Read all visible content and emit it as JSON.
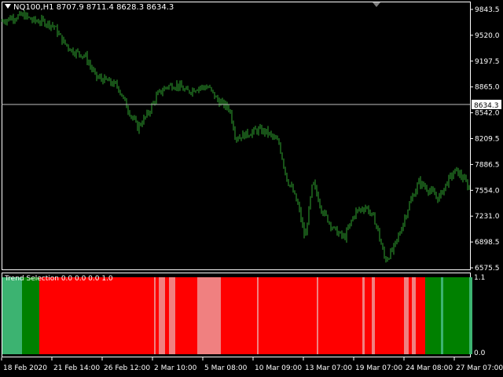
{
  "window": {
    "symbol": "NQ100,H1",
    "ohlc": [
      "8707.9",
      "8711.4",
      "8628.3",
      "8634.3"
    ]
  },
  "indicator": {
    "label": "Trend Selection 0.0 0.0 0.0 1.0",
    "scale": [
      "1.1",
      "0.0"
    ]
  },
  "price_axis": {
    "ticks": [
      "9843.5",
      "9520.0",
      "9197.5",
      "8865.0",
      "8542.0",
      "8209.5",
      "7886.5",
      "7554.0",
      "7231.0",
      "6898.5",
      "6575.5"
    ],
    "current_price": "8634.3"
  },
  "time_axis": {
    "ticks": [
      "18 Feb 2020",
      "21 Feb 14:00",
      "26 Feb 12:00",
      "2 Mar 10:00",
      "5 Mar 08:00",
      "10 Mar 09:00",
      "13 Mar 07:00",
      "19 Mar 07:00",
      "24 Mar 08:00",
      "27 Mar 07:00"
    ]
  },
  "colors": {
    "background": "#000000",
    "candle": "#2fa52f",
    "axis": "#ffffff",
    "price_line": "#c0c0c0",
    "red": "#ff0000",
    "light_red": "#f08080",
    "green": "#008000",
    "light_green": "#3cb371"
  },
  "chart_data": {
    "type": "line",
    "x": [
      "18 Feb 2020",
      "21 Feb 14:00",
      "26 Feb 12:00",
      "2 Mar 10:00",
      "5 Mar 08:00",
      "10 Mar 09:00",
      "13 Mar 07:00",
      "19 Mar 07:00",
      "24 Mar 08:00",
      "27 Mar 07:00"
    ],
    "series": [
      {
        "values": [
          9690,
          9620,
          8880,
          8340,
          8700,
          8440,
          7620,
          7050,
          7380,
          7720
        ]
      }
    ],
    "price_path": [
      [
        0,
        9690
      ],
      [
        15,
        9740
      ],
      [
        30,
        9770
      ],
      [
        42,
        9700
      ],
      [
        55,
        9690
      ],
      [
        68,
        9640
      ],
      [
        80,
        9440
      ],
      [
        92,
        9320
      ],
      [
        108,
        9260
      ],
      [
        122,
        8990
      ],
      [
        136,
        8940
      ],
      [
        150,
        8870
      ],
      [
        162,
        8600
      ],
      [
        175,
        8350
      ],
      [
        188,
        8520
      ],
      [
        200,
        8760
      ],
      [
        212,
        8870
      ],
      [
        225,
        8890
      ],
      [
        238,
        8800
      ],
      [
        252,
        8860
      ],
      [
        265,
        8860
      ],
      [
        278,
        8680
      ],
      [
        292,
        8590
      ],
      [
        300,
        8220
      ],
      [
        315,
        8270
      ],
      [
        328,
        8320
      ],
      [
        340,
        8290
      ],
      [
        355,
        8150
      ],
      [
        365,
        7700
      ],
      [
        372,
        7560
      ],
      [
        380,
        7340
      ],
      [
        388,
        6940
      ],
      [
        398,
        7660
      ],
      [
        410,
        7300
      ],
      [
        425,
        7060
      ],
      [
        438,
        6950
      ],
      [
        452,
        7280
      ],
      [
        466,
        7350
      ],
      [
        478,
        7150
      ],
      [
        490,
        6670
      ],
      [
        500,
        6800
      ],
      [
        508,
        7000
      ],
      [
        520,
        7360
      ],
      [
        533,
        7660
      ],
      [
        546,
        7560
      ],
      [
        558,
        7450
      ],
      [
        570,
        7680
      ],
      [
        580,
        7810
      ],
      [
        590,
        7700
      ],
      [
        598,
        7560
      ]
    ],
    "ylim": [
      6575.5,
      9843.5
    ],
    "indicator_bands": [
      [
        0,
        25,
        "light_green"
      ],
      [
        25,
        47,
        "green"
      ],
      [
        47,
        193,
        "red"
      ],
      [
        193,
        195,
        "light_red"
      ],
      [
        195,
        199,
        "red"
      ],
      [
        199,
        207,
        "light_red"
      ],
      [
        207,
        212,
        "red"
      ],
      [
        212,
        220,
        "light_red"
      ],
      [
        220,
        248,
        "red"
      ],
      [
        248,
        278,
        "light_red"
      ],
      [
        278,
        324,
        "red"
      ],
      [
        324,
        326,
        "light_red"
      ],
      [
        326,
        400,
        "red"
      ],
      [
        400,
        402,
        "light_red"
      ],
      [
        402,
        458,
        "red"
      ],
      [
        458,
        461,
        "light_red"
      ],
      [
        461,
        470,
        "red"
      ],
      [
        470,
        474,
        "light_red"
      ],
      [
        474,
        511,
        "red"
      ],
      [
        511,
        517,
        "light_red"
      ],
      [
        517,
        521,
        "red"
      ],
      [
        521,
        526,
        "light_red"
      ],
      [
        526,
        538,
        "red"
      ],
      [
        538,
        558,
        "green"
      ],
      [
        558,
        561,
        "light_green"
      ],
      [
        561,
        594,
        "green"
      ],
      [
        594,
        598,
        "light_green"
      ]
    ]
  }
}
